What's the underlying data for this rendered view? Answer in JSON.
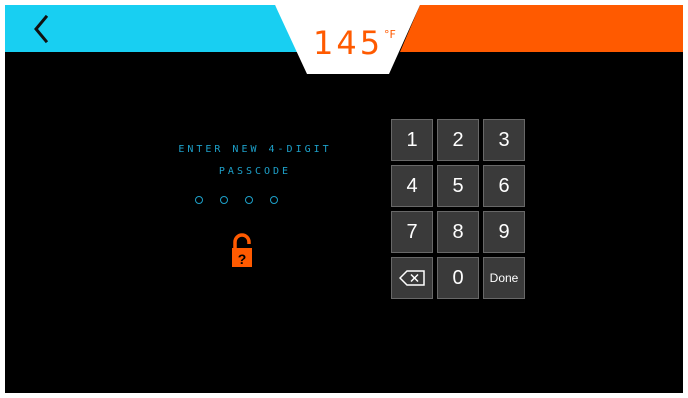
{
  "header": {
    "temperature": "145",
    "unit": "°F",
    "back_icon": "chevron-left-icon",
    "colors": {
      "left_band": "#18cff2",
      "right_band": "#ff5a00",
      "temp_text": "#ff5a00",
      "notch": "#ffffff"
    }
  },
  "prompt": {
    "line1": "ENTER NEW 4-DIGIT",
    "line2": "PASSCODE",
    "color": "#1da0c9"
  },
  "passcode": {
    "digits_total": 4,
    "digits_entered": 0
  },
  "lock_icon": {
    "name": "padlock-question-icon",
    "color": "#ff5a00"
  },
  "keypad": {
    "keys": [
      "1",
      "2",
      "3",
      "4",
      "5",
      "6",
      "7",
      "8",
      "9",
      "backspace",
      "0",
      "Done"
    ],
    "done_label": "Done",
    "backspace_icon": "backspace-icon"
  }
}
